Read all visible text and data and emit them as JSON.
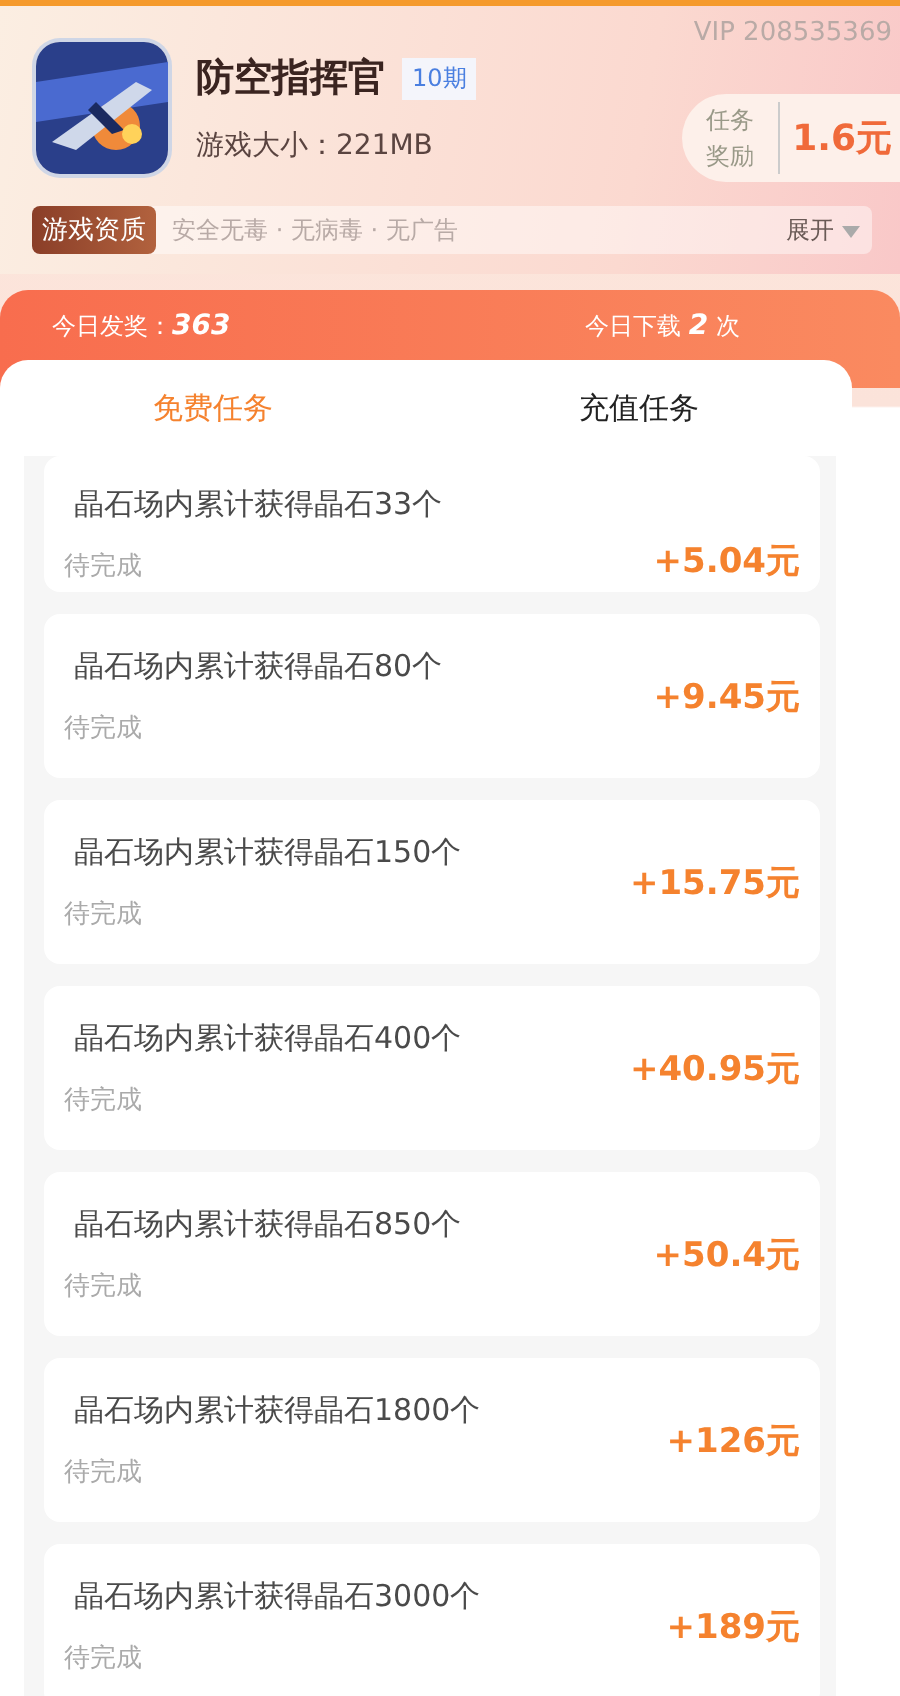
{
  "vip": "VIP 208535369",
  "game": {
    "title": "防空指挥官",
    "issue": "10期",
    "size": "游戏大小：221MB",
    "reward_label": "任务奖励",
    "reward": "1.6元"
  },
  "quality": {
    "tag": "游戏资质",
    "items": "安全无毒 · 无病毒 · 无广告",
    "expand": "展开"
  },
  "stats": {
    "awards": "今日发奖：",
    "awards_value": "363",
    "downloads": "今日下载",
    "downloads_value": "2",
    "downloads_unit": "次"
  },
  "tabs": [
    {
      "label": "免费任务",
      "selected": true
    },
    {
      "label": "充值任务",
      "selected": false
    }
  ],
  "tasks": [
    {
      "title": "晶石场内累计获得晶石33个",
      "status": "待完成",
      "reward": "+5.04元"
    },
    {
      "title": "晶石场内累计获得晶石80个",
      "status": "待完成",
      "reward": "+9.45元"
    },
    {
      "title": "晶石场内累计获得晶石150个",
      "status": "待完成",
      "reward": "+15.75元"
    },
    {
      "title": "晶石场内累计获得晶石400个",
      "status": "待完成",
      "reward": "+40.95元"
    },
    {
      "title": "晶石场内累计获得晶石850个",
      "status": "待完成",
      "reward": "+50.4元"
    },
    {
      "title": "晶石场内累计获得晶石1800个",
      "status": "待完成",
      "reward": "+126元"
    },
    {
      "title": "晶石场内累计获得晶石3000个",
      "status": "待完成",
      "reward": "+189元"
    }
  ]
}
